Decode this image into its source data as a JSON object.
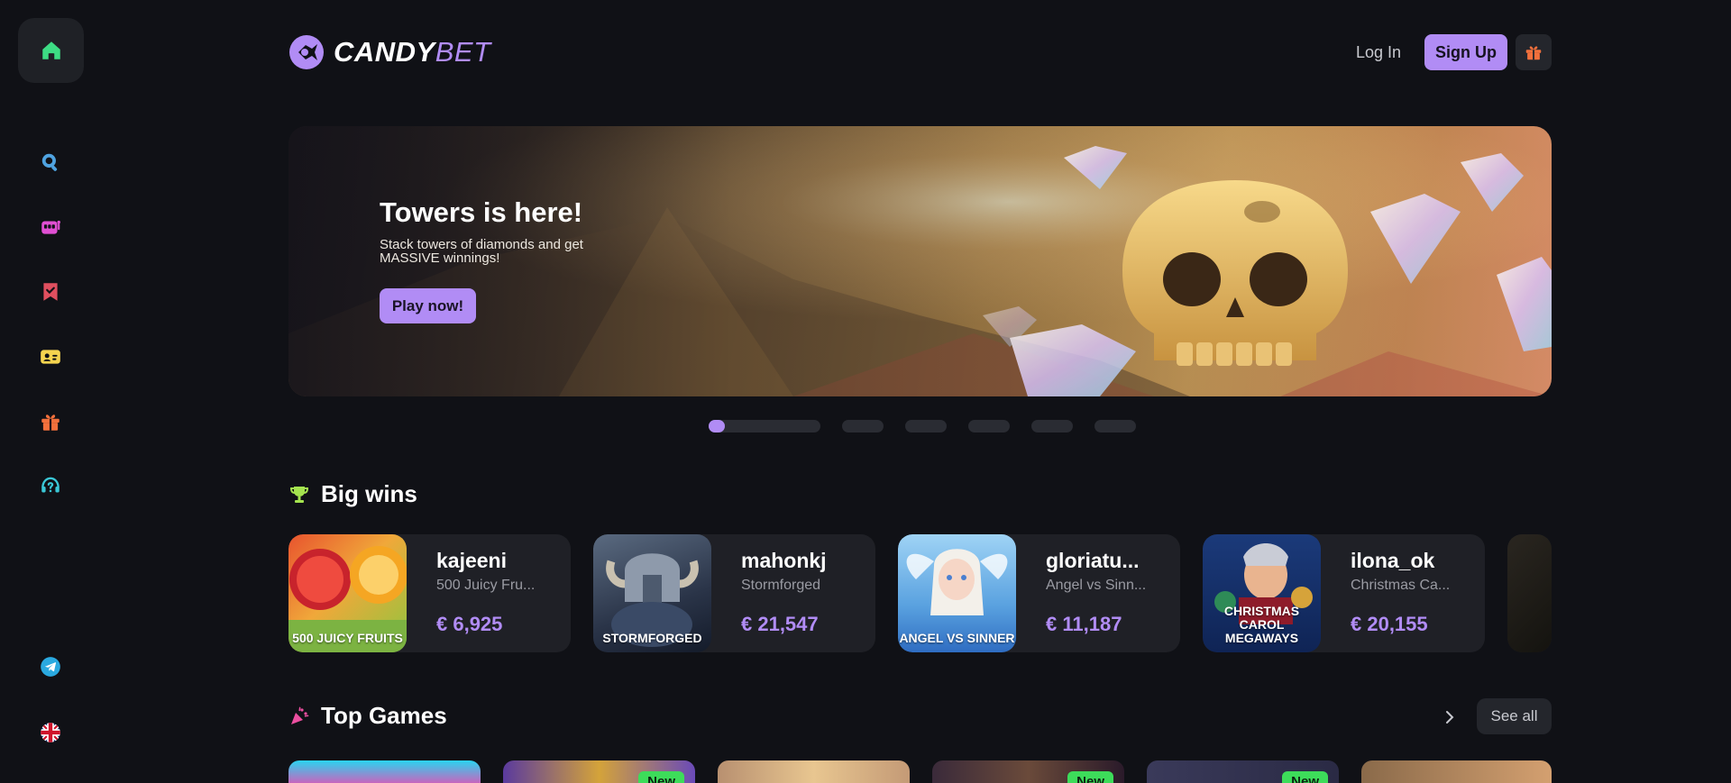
{
  "brand": {
    "name_part1": "CANDY",
    "name_part2": "BET",
    "accent": "#b18cf5"
  },
  "sidebar": {
    "items": [
      {
        "icon": "home-icon",
        "color": "#3ddc84"
      },
      {
        "icon": "search-icon",
        "color": "#4fa3e0"
      },
      {
        "icon": "slot-machine-icon",
        "color": "#e04fd3"
      },
      {
        "icon": "bookmark-icon",
        "color": "#e04f5f"
      },
      {
        "icon": "id-card-icon",
        "color": "#f5d44f"
      },
      {
        "icon": "gift-icon",
        "color": "#f2703c"
      },
      {
        "icon": "support-icon",
        "color": "#3ac7d6"
      },
      {
        "icon": "telegram-icon",
        "color": "#2aa9e0"
      },
      {
        "icon": "uk-flag-icon",
        "color": "#cf142b"
      }
    ]
  },
  "header": {
    "login_label": "Log In",
    "signup_label": "Sign Up",
    "gift_icon": "gift-icon"
  },
  "banner": {
    "title": "Towers is here!",
    "subtitle": "Stack towers of diamonds and get MASSIVE winnings!",
    "cta_label": "Play now!"
  },
  "carousel": {
    "total_slides": 6,
    "active_index": 0
  },
  "big_wins": {
    "title": "Big wins",
    "items": [
      {
        "user": "kajeeni",
        "game": "500 Juicy Fru...",
        "amount": "€ 6,925",
        "thumb_label": "500 JUICY FRUITS"
      },
      {
        "user": "mahonkj",
        "game": "Stormforged",
        "amount": "€ 21,547",
        "thumb_label": "STORMFORGED"
      },
      {
        "user": "gloriatu...",
        "game": "Angel vs Sinn...",
        "amount": "€ 11,187",
        "thumb_label": "ANGEL VS SINNER"
      },
      {
        "user": "ilona_ok",
        "game": "Christmas Ca...",
        "amount": "€ 20,155",
        "thumb_label": "CHRISTMAS CAROL MEGAWAYS"
      }
    ]
  },
  "top_games": {
    "title": "Top Games",
    "see_all_label": "See all",
    "badge_new": "New"
  }
}
